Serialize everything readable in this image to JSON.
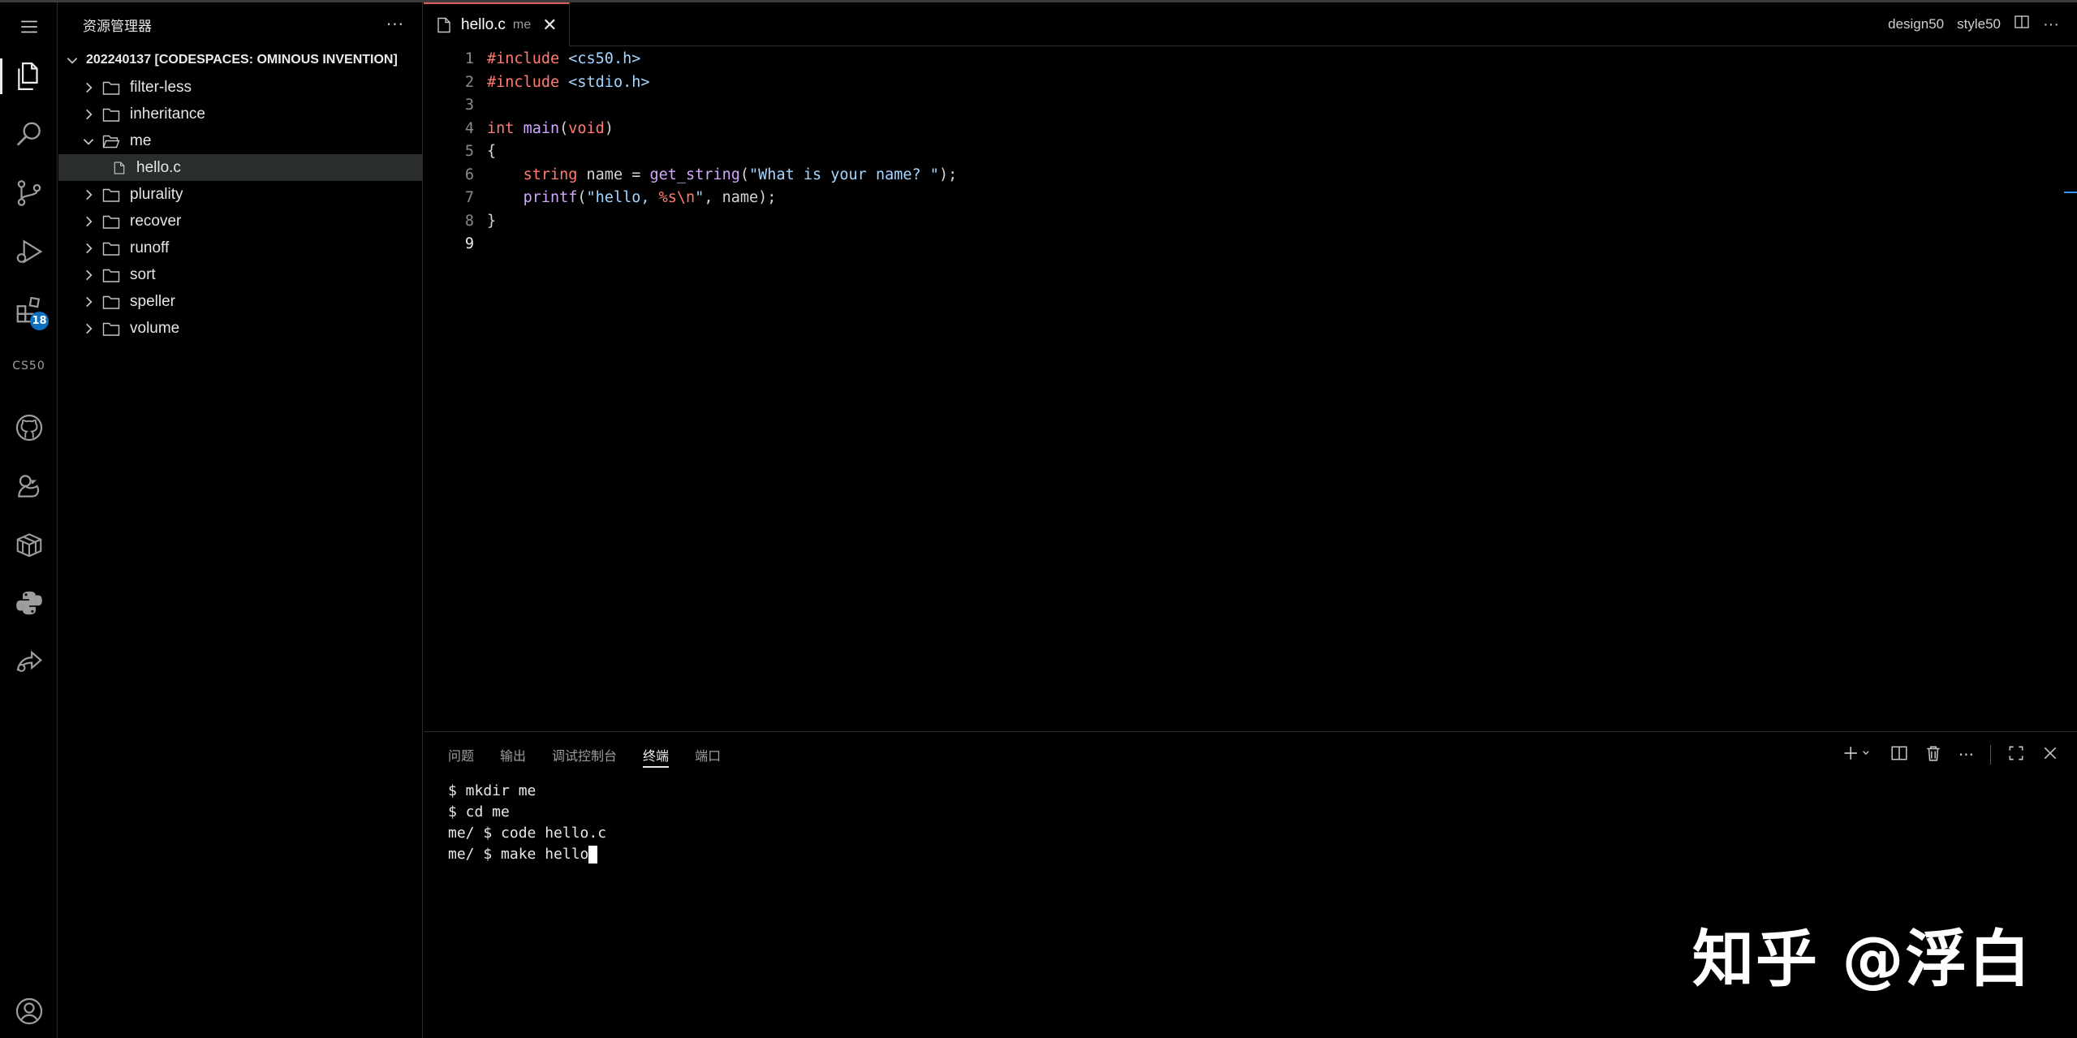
{
  "sidebar": {
    "title": "资源管理器",
    "more": "···",
    "root": "202240137 [CODESPACES: OMINOUS INVENTION]",
    "items": [
      {
        "label": "filter-less"
      },
      {
        "label": "inheritance"
      },
      {
        "label": "me"
      },
      {
        "label": "hello.c"
      },
      {
        "label": "plurality"
      },
      {
        "label": "recover"
      },
      {
        "label": "runoff"
      },
      {
        "label": "sort"
      },
      {
        "label": "speller"
      },
      {
        "label": "volume"
      }
    ]
  },
  "activity": {
    "extensions_badge": "18",
    "cs50_label": "CS50"
  },
  "editor": {
    "tab": {
      "name": "hello.c",
      "desc": "me",
      "close": "✕"
    },
    "right_actions": {
      "design": "design50",
      "style": "style50"
    },
    "line_numbers": [
      "1",
      "2",
      "3",
      "4",
      "5",
      "6",
      "7",
      "8",
      "9"
    ],
    "code": {
      "l1_pre": "#include",
      "l1_inc": "<cs50.h>",
      "l2_pre": "#include",
      "l2_inc": "<stdio.h>",
      "l4_type": "int",
      "l4_fn": "main",
      "l4_open": "(",
      "l4_void": "void",
      "l4_close": ")",
      "l5": "{",
      "l6_indent": "    ",
      "l6_type": "string",
      "l6_mid": " name = ",
      "l6_fn": "get_string",
      "l6_open": "(",
      "l6_str": "\"What is your name? \"",
      "l6_end": ");",
      "l7_indent": "    ",
      "l7_fn": "printf",
      "l7_open": "(",
      "l7_str1": "\"hello, ",
      "l7_fmt": "%s\\n",
      "l7_str2": "\"",
      "l7_rest": ", name);",
      "l8": "}"
    }
  },
  "panel": {
    "tabs": [
      "问题",
      "输出",
      "调试控制台",
      "终端",
      "端口"
    ],
    "active_tab": "终端",
    "terminal": [
      "$ mkdir me",
      "$ cd me",
      "me/ $ code hello.c",
      "me/ $ make hello"
    ]
  },
  "watermark": "知乎 @浮白"
}
